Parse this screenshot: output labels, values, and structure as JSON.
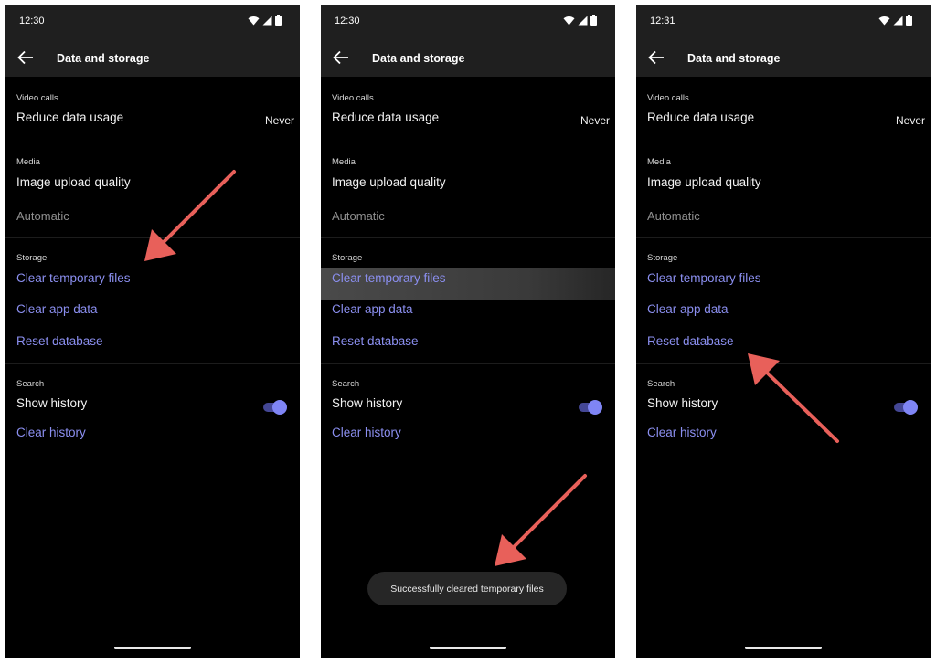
{
  "screens": [
    {
      "time": "12:30",
      "title": "Data and storage",
      "sections": {
        "video_calls": {
          "header": "Video calls",
          "label": "Reduce data usage",
          "value": "Never"
        },
        "media": {
          "header": "Media",
          "label": "Image upload quality",
          "value": "Automatic"
        },
        "storage": {
          "header": "Storage",
          "items": [
            "Clear temporary files",
            "Clear app data",
            "Reset database"
          ]
        },
        "search": {
          "header": "Search",
          "label": "Show history",
          "toggle_on": true,
          "clear_label": "Clear history"
        }
      }
    },
    {
      "time": "12:30",
      "title": "Data and storage",
      "highlighted_item": "Clear temporary files",
      "sections": {
        "video_calls": {
          "header": "Video calls",
          "label": "Reduce data usage",
          "value": "Never"
        },
        "media": {
          "header": "Media",
          "label": "Image upload quality",
          "value": "Automatic"
        },
        "storage": {
          "header": "Storage",
          "items": [
            "Clear temporary files",
            "Clear app data",
            "Reset database"
          ]
        },
        "search": {
          "header": "Search",
          "label": "Show history",
          "toggle_on": true,
          "clear_label": "Clear history"
        }
      },
      "toast": "Successfully cleared temporary files"
    },
    {
      "time": "12:31",
      "title": "Data and storage",
      "sections": {
        "video_calls": {
          "header": "Video calls",
          "label": "Reduce data usage",
          "value": "Never"
        },
        "media": {
          "header": "Media",
          "label": "Image upload quality",
          "value": "Automatic"
        },
        "storage": {
          "header": "Storage",
          "items": [
            "Clear temporary files",
            "Clear app data",
            "Reset database"
          ]
        },
        "search": {
          "header": "Search",
          "label": "Show history",
          "toggle_on": true,
          "clear_label": "Clear history"
        }
      }
    }
  ],
  "colors": {
    "link": "#8b8ff0",
    "toggle": "#7f85f5",
    "annotation_arrow": "#e8605a",
    "bar_background": "#1f1f1f"
  },
  "icons": [
    "wifi-icon",
    "signal-icon",
    "battery-icon",
    "back-arrow-icon"
  ]
}
